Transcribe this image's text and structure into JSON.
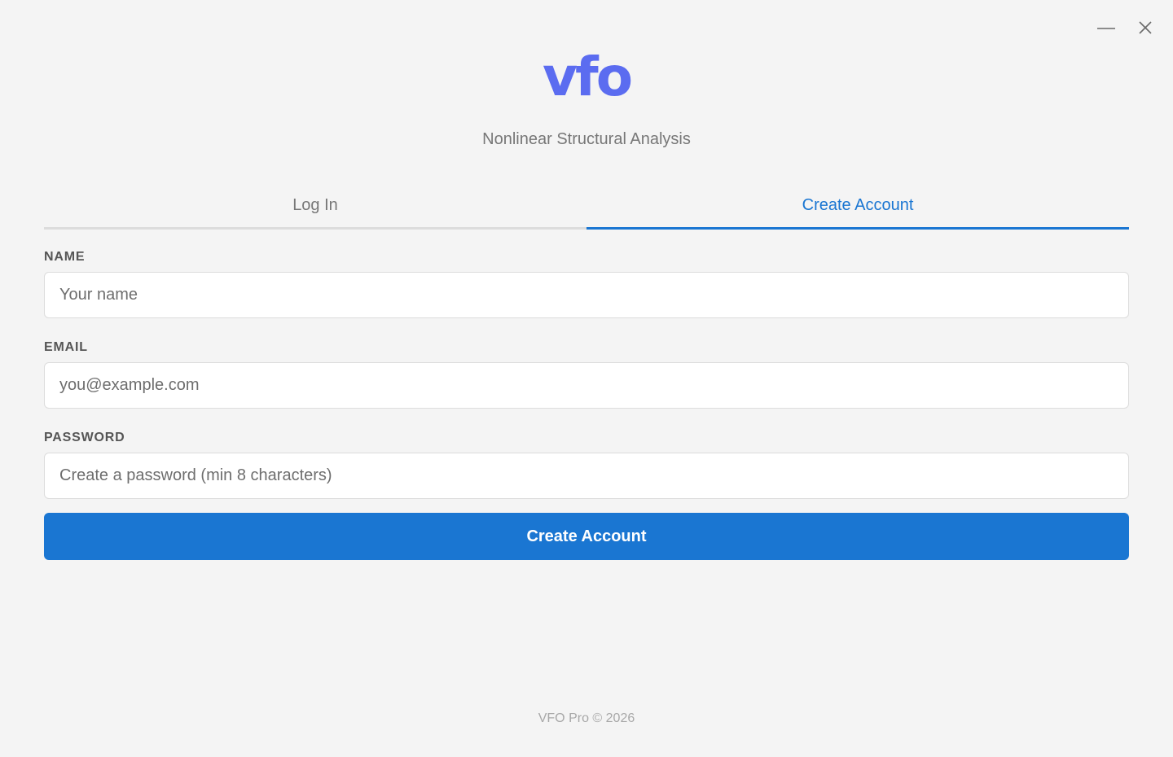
{
  "window": {
    "controls": {
      "minimize_icon": "minimize-icon",
      "close_icon": "close-icon"
    }
  },
  "brand": {
    "logo_text": "vfo",
    "subtitle": "Nonlinear Structural Analysis"
  },
  "colors": {
    "accent": "#1a76d2",
    "logo": "#5b6cf0",
    "background": "#f4f4f4"
  },
  "tabs": [
    {
      "label": "Log In",
      "active": false
    },
    {
      "label": "Create Account",
      "active": true
    }
  ],
  "form": {
    "name": {
      "label": "NAME",
      "value": "",
      "placeholder": "Your name"
    },
    "email": {
      "label": "EMAIL",
      "value": "",
      "placeholder": "you@example.com"
    },
    "password": {
      "label": "PASSWORD",
      "value": "",
      "placeholder": "Create a password (min 8 characters)"
    },
    "submit_label": "Create Account"
  },
  "footer": {
    "text": "VFO Pro © 2026"
  }
}
